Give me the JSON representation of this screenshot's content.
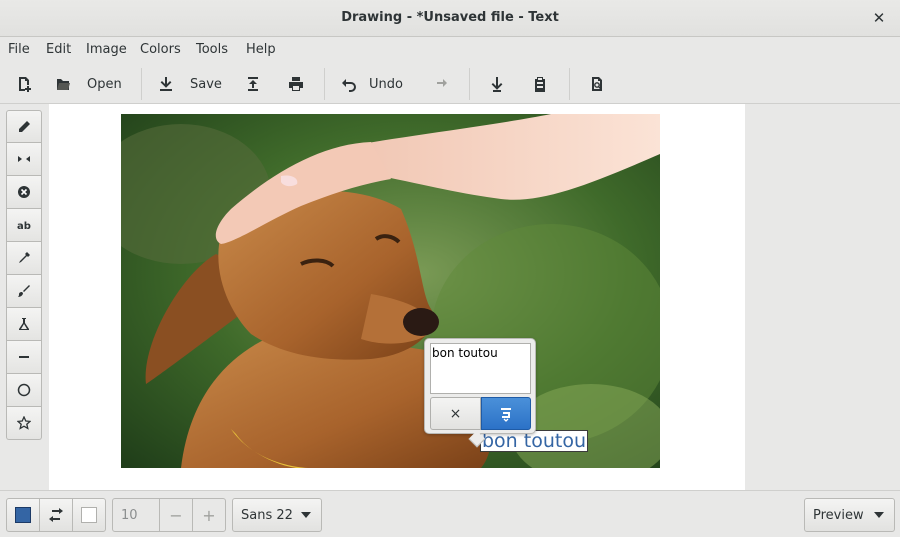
{
  "window": {
    "title": "Drawing - *Unsaved file - Text",
    "close_glyph": "✕"
  },
  "menu": {
    "items": [
      "File",
      "Edit",
      "Image",
      "Colors",
      "Tools",
      "Help"
    ]
  },
  "toolbar": {
    "open_label": "Open",
    "save_label": "Save",
    "undo_label": "Undo"
  },
  "tools": [
    "pencil-icon",
    "mirror-icon",
    "erase-icon",
    "text-icon",
    "picker-icon",
    "brush-icon",
    "flask-icon",
    "line-icon",
    "circle-icon",
    "star-icon"
  ],
  "text_tool": {
    "input_value": "bon toutou",
    "preview_text": "bon toutou",
    "cancel_glyph": "×"
  },
  "bottom": {
    "main_color": "#3465a4",
    "secondary_color": "#ffffff",
    "size_value": "10",
    "minus_glyph": "−",
    "plus_glyph": "+",
    "font_label": "Sans 22",
    "preview_label": "Preview"
  },
  "colors": {
    "accent": "#3b86db",
    "background": "#e8e8e7"
  }
}
